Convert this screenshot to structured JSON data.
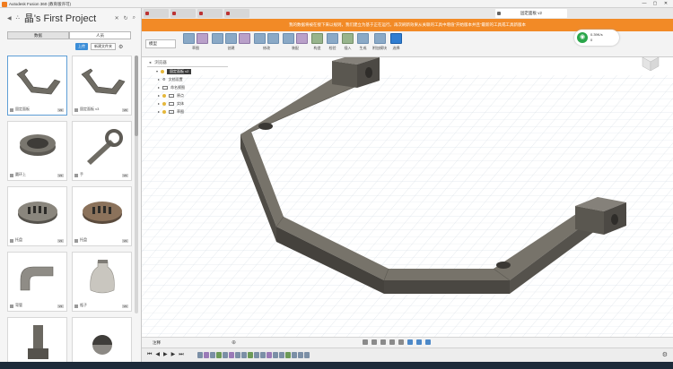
{
  "window": {
    "app_title": "Autodesk Fusion 360 (教育版许可)"
  },
  "data_panel": {
    "project_title": "晶's First Project",
    "tabs": [
      "数据",
      "人员"
    ],
    "upload_label": "上传",
    "new_folder_label": "新建文件夹",
    "thumbnails": [
      {
        "name": "固定面板",
        "version": "V2"
      },
      {
        "name": "固定面板 v3",
        "version": "V3"
      },
      {
        "name": "圆环上",
        "version": "V1"
      },
      {
        "name": "手",
        "version": "V1"
      },
      {
        "name": "托盘",
        "version": "V1"
      },
      {
        "name": "托盘",
        "version": "V1"
      },
      {
        "name": "弯管",
        "version": "V1"
      },
      {
        "name": "瓶子",
        "version": "V1"
      },
      {
        "name": "",
        "version": ""
      },
      {
        "name": "",
        "version": ""
      }
    ]
  },
  "document": {
    "active_tab": "固定面板 v2"
  },
  "banner": {
    "text": "我的数据将被在接下来以规则，我们建立为基于正在运行。再次刷新效果从关联的工具中增值“开始版本并且”最新的工具或工具新版本"
  },
  "toolbar": {
    "workspace": "模型",
    "groups": [
      "草图",
      "创建",
      "修改",
      "装配",
      "构造",
      "检验",
      "插入",
      "生成",
      "附加模块",
      "选择"
    ]
  },
  "network": {
    "speed_up": "0.39K/s",
    "speed_down": "0"
  },
  "browser": {
    "header": "浏览器",
    "root": "固定面板 v2",
    "items": [
      "文档设置",
      "命名视图",
      "原点",
      "实体",
      "草图"
    ]
  },
  "status": {
    "comments_label": "注释"
  }
}
